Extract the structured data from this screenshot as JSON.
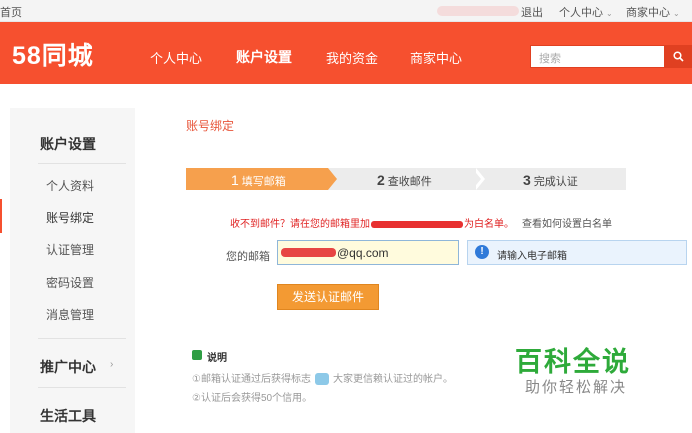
{
  "topbar": {
    "home": "首页",
    "logout": "退出",
    "personal_center": "个人中心",
    "merchant_center": "商家中心",
    "chevron": "⌄"
  },
  "header": {
    "logo": "58同城",
    "nav": [
      "个人中心",
      "账户设置",
      "我的资金",
      "商家中心"
    ],
    "active_nav": "账户设置",
    "search_placeholder": "搜索",
    "search_icon": "magnifier-icon",
    "accent_color": "#f6502f"
  },
  "sidebar": {
    "section_account": "账户设置",
    "items": [
      "个人资料",
      "账号绑定",
      "认证管理",
      "密码设置",
      "消息管理"
    ],
    "active_item": "账号绑定",
    "section_promo": "推广中心",
    "promo_arrow": "›",
    "section_tools": "生活工具"
  },
  "main": {
    "page_title": "账号绑定",
    "steps": [
      {
        "num": "1",
        "label": "填写邮箱"
      },
      {
        "num": "2",
        "label": "查收邮件"
      },
      {
        "num": "3",
        "label": "完成认证"
      }
    ],
    "current_step": 1,
    "notice_prefix": "收不到邮件？请在您的邮箱里加",
    "notice_suffix": "为白名单。",
    "notice_help": "查看如何设置白名单",
    "email_label": "您的邮箱",
    "email_value": "@qq.com",
    "tip_icon": "info-icon",
    "tip_text": "请输入电子邮箱",
    "send_button": "发送认证邮件",
    "note_title": "说明",
    "note_line1_a": "①邮箱认证通过后获得标志",
    "note_line1_b": "大家更信赖认证过的帐户。",
    "note_line2": "②认证后会获得50个信用。"
  },
  "watermark": {
    "big": "百科全说",
    "small": "助你轻松解决"
  }
}
